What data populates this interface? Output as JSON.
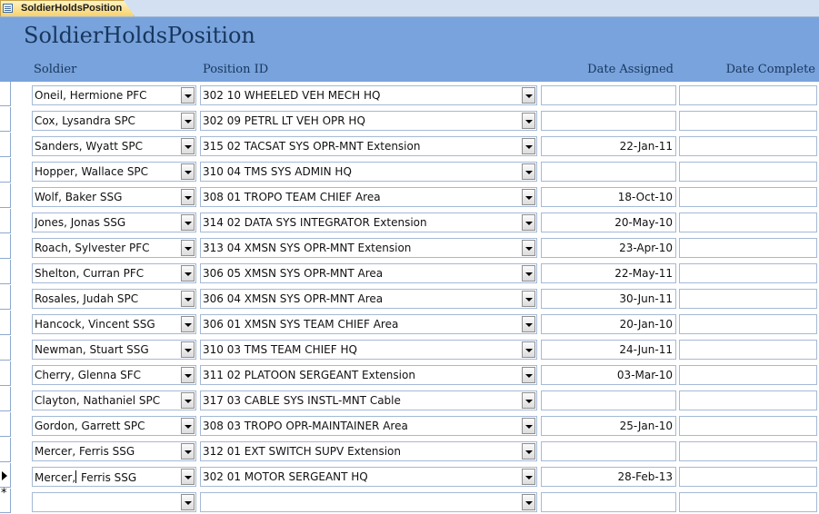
{
  "document_tab": {
    "title": "SoldierHoldsPosition"
  },
  "form": {
    "title": "SoldierHoldsPosition",
    "columns": {
      "soldier": "Soldier",
      "position_id": "Position ID",
      "date_assigned": "Date Assigned",
      "date_complete": "Date Complete"
    }
  },
  "records": [
    {
      "soldier": "Oneil,  Hermione PFC",
      "position": "302 10 WHEELED VEH MECH HQ",
      "date_assigned": "",
      "date_complete": ""
    },
    {
      "soldier": "Cox,  Lysandra SPC",
      "position": "302 09 PETRL LT VEH OPR HQ",
      "date_assigned": "",
      "date_complete": ""
    },
    {
      "soldier": "Sanders,  Wyatt SPC",
      "position": "315 02 TACSAT SYS OPR-MNT Extension",
      "date_assigned": "22-Jan-11",
      "date_complete": ""
    },
    {
      "soldier": "Hopper,  Wallace SPC",
      "position": "310 04 TMS SYS ADMIN HQ",
      "date_assigned": "",
      "date_complete": ""
    },
    {
      "soldier": "Wolf,  Baker SSG",
      "position": "308 01 TROPO TEAM CHIEF Area",
      "date_assigned": "18-Oct-10",
      "date_complete": ""
    },
    {
      "soldier": "Jones,  Jonas SSG",
      "position": "314 02 DATA SYS INTEGRATOR Extension",
      "date_assigned": "20-May-10",
      "date_complete": ""
    },
    {
      "soldier": "Roach,  Sylvester PFC",
      "position": "313 04 XMSN SYS OPR-MNT Extension",
      "date_assigned": "23-Apr-10",
      "date_complete": ""
    },
    {
      "soldier": "Shelton,  Curran PFC",
      "position": "306 05 XMSN SYS OPR-MNT Area",
      "date_assigned": "22-May-11",
      "date_complete": ""
    },
    {
      "soldier": "Rosales,  Judah SPC",
      "position": "306 04 XMSN SYS OPR-MNT Area",
      "date_assigned": "30-Jun-11",
      "date_complete": ""
    },
    {
      "soldier": "Hancock,  Vincent SSG",
      "position": "306 01 XMSN SYS TEAM CHIEF Area",
      "date_assigned": "20-Jan-10",
      "date_complete": ""
    },
    {
      "soldier": "Newman,  Stuart SSG",
      "position": "310 03 TMS TEAM CHIEF HQ",
      "date_assigned": "24-Jun-11",
      "date_complete": ""
    },
    {
      "soldier": "Cherry,  Glenna SFC",
      "position": "311 02 PLATOON SERGEANT Extension",
      "date_assigned": "03-Mar-10",
      "date_complete": ""
    },
    {
      "soldier": "Clayton,  Nathaniel SPC",
      "position": "317 03 CABLE SYS INSTL-MNT Cable",
      "date_assigned": "",
      "date_complete": ""
    },
    {
      "soldier": "Gordon,  Garrett SPC",
      "position": "308 03 TROPO OPR-MAINTAINER Area",
      "date_assigned": "25-Jan-10",
      "date_complete": ""
    },
    {
      "soldier": "Mercer,  Ferris SSG",
      "position": "312 01 EXT SWITCH SUPV Extension",
      "date_assigned": "",
      "date_complete": ""
    },
    {
      "soldier": "Mercer,  Ferris SSG",
      "position": "302 01 MOTOR SERGEANT HQ",
      "date_assigned": "28-Feb-13",
      "date_complete": ""
    }
  ],
  "new_record": {
    "soldier": "",
    "position": "",
    "date_assigned": "",
    "date_complete": ""
  },
  "current_record_index": 15,
  "icons": {
    "tab": "form-icon",
    "dropdown": "dropdown-arrow-icon",
    "current_record": "current-record-arrow-icon",
    "new_record": "new-record-star-icon"
  },
  "colors": {
    "header_band": "#79a3dc",
    "title_text": "#17365d",
    "tab_fill": "#f7d26c",
    "field_border": "#a5b9d5"
  }
}
